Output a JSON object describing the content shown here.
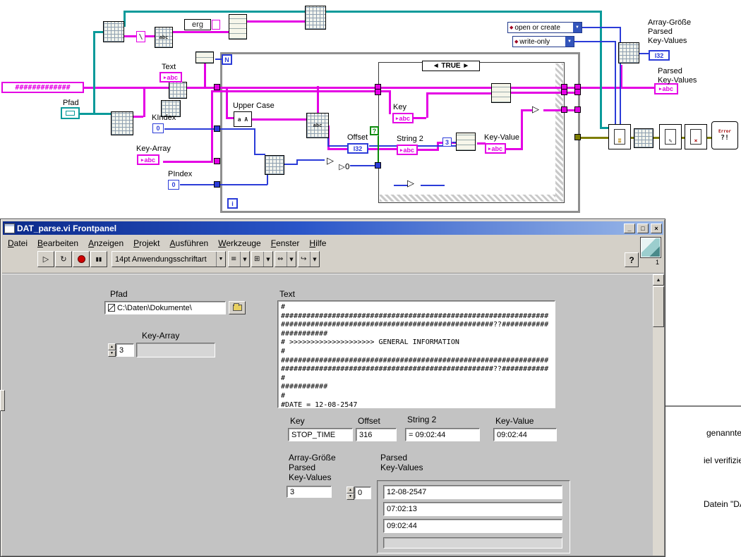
{
  "bd": {
    "hash_const": "#############",
    "erg": "erg",
    "backslash": "\\",
    "abc": "abc",
    "i32": "I32",
    "zero": "0",
    "three": "3",
    "n": "N",
    "i": "i",
    "q": "?",
    "true_sel": "◄ TRUE ►",
    "combo1": "open or create",
    "combo2": "write-only",
    "upper_glyph": "a A",
    "tri": "▷",
    "gt0": "▷0",
    "error_word": "Error",
    "error_marks": "?!",
    "labels": {
      "pfad": "Pfad",
      "text": "Text",
      "kindex": "KIndex",
      "key_array": "Key-Array",
      "pindex": "PIndex",
      "upper_case": "Upper Case",
      "offset": "Offset",
      "key": "Key",
      "string2": "String 2",
      "key_value": "Key-Value",
      "array_size": "Array-Größe\nParsed\nKey-Values",
      "parsed": "Parsed\nKey-Values"
    }
  },
  "icons": {
    "min": "_",
    "max": "□",
    "close": "×",
    "run": "▷",
    "run_cont": "↻",
    "pause": "▮▮",
    "dropdown": "▼",
    "up": "▲",
    "down": "▼",
    "help": "?",
    "badge": "1",
    "ring": "◆",
    "write_file": "✎",
    "close_file": "×"
  },
  "fp": {
    "title": "DAT_parse.vi Frontpanel",
    "menu": [
      "Datei",
      "Bearbeiten",
      "Anzeigen",
      "Projekt",
      "Ausführen",
      "Werkzeuge",
      "Fenster",
      "Hilfe"
    ],
    "toolbar": {
      "font": "14pt Anwendungsschriftart",
      "combo_glyphs": [
        "≡",
        "⊞",
        "⇔",
        "↪"
      ]
    },
    "pfad_label": "Pfad",
    "pfad_value": "C:\\Daten\\Dokumente\\",
    "key_array_label": "Key-Array",
    "key_array_index": "3",
    "text_label": "Text",
    "text_lines": [
      "#",
      "###############################################################",
      "##################################################??###########",
      "###########",
      "# >>>>>>>>>>>>>>>>>>>> GENERAL INFORMATION",
      "#",
      "###############################################################",
      "##################################################??###########",
      "#",
      "###########",
      "#",
      "#DATE = 12-08-2547"
    ],
    "key_label": "Key",
    "key_value": "STOP_TIME",
    "offset_label": "Offset",
    "offset_value": "316",
    "string2_label": "String 2",
    "string2_value": "= 09:02:44",
    "keyvalue_label": "Key-Value",
    "keyvalue_value": "09:02:44",
    "arrsize_label": "Array-Größe\nParsed\nKey-Values",
    "arrsize_value": "3",
    "parsed_label": "Parsed\nKey-Values",
    "parsed_index": "0",
    "parsed_values": [
      "12-08-2547",
      "07:02:13",
      "09:02:44"
    ]
  },
  "bg_window": {
    "fragments": [
      "genannte Keys",
      "iel verifiziert, da",
      "Datein \"DAT_na"
    ]
  }
}
